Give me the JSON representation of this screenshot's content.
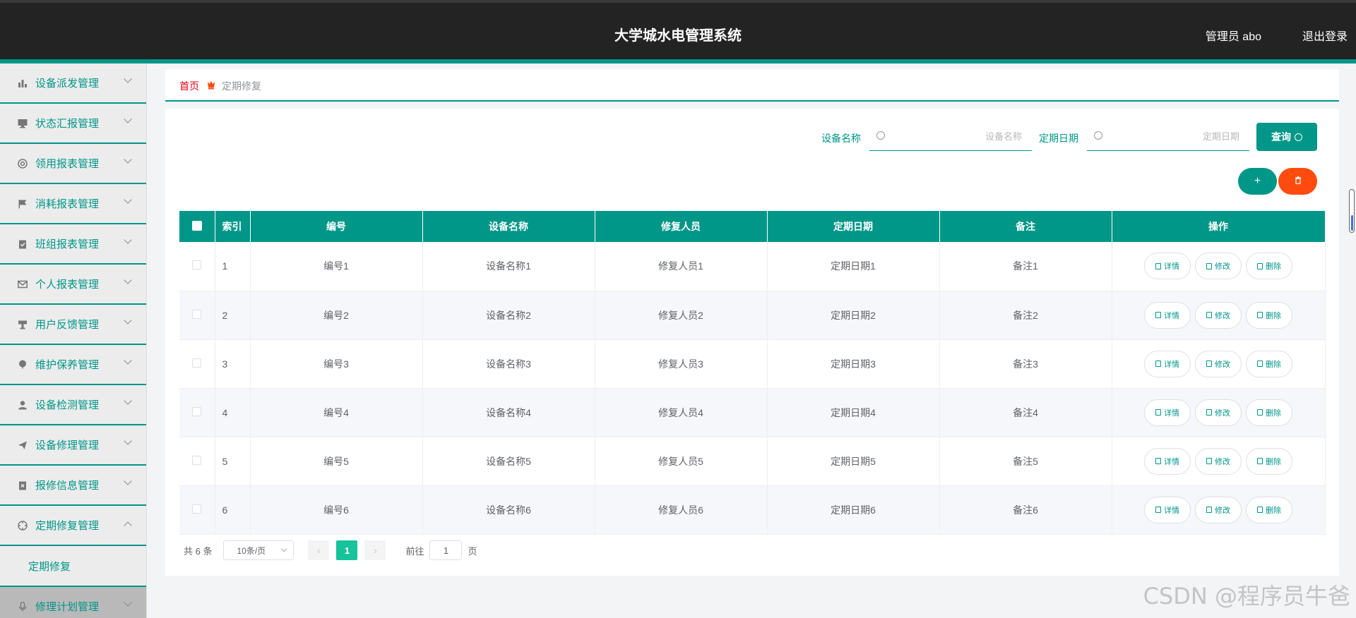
{
  "header": {
    "title": "大学城水电管理系统",
    "user": "管理员 abo",
    "logout": "退出登录"
  },
  "sidebar": {
    "items": [
      {
        "label": "设备派发管理",
        "icon": "bar-chart-icon"
      },
      {
        "label": "状态汇报管理",
        "icon": "monitor-icon"
      },
      {
        "label": "领用报表管理",
        "icon": "lifebuoy-icon"
      },
      {
        "label": "消耗报表管理",
        "icon": "flag-icon"
      },
      {
        "label": "班组报表管理",
        "icon": "clipboard-check-icon"
      },
      {
        "label": "个人报表管理",
        "icon": "mail-icon"
      },
      {
        "label": "用户反馈管理",
        "icon": "stamp-icon"
      },
      {
        "label": "维护保养管理",
        "icon": "balloon-icon"
      },
      {
        "label": "设备检测管理",
        "icon": "user-icon"
      },
      {
        "label": "设备修理管理",
        "icon": "paper-plane-icon"
      },
      {
        "label": "报修信息管理",
        "icon": "clipboard-x-icon"
      },
      {
        "label": "定期修复管理",
        "icon": "crosshair-icon"
      }
    ],
    "sub_item": "定期修复",
    "last_item": {
      "label": "修理计划管理",
      "icon": "microphone-icon"
    }
  },
  "breadcrumb": {
    "home": "首页",
    "current": "定期修复"
  },
  "search": {
    "name_label": "设备名称",
    "name_placeholder": "设备名称",
    "date_label": "定期日期",
    "date_placeholder": "定期日期",
    "query_label": "查询"
  },
  "actions": {
    "add": "+",
    "delete_icon": "trash-icon"
  },
  "table": {
    "headers": [
      "索引",
      "编号",
      "设备名称",
      "修复人员",
      "定期日期",
      "备注",
      "操作"
    ],
    "rows": [
      [
        "1",
        "编号1",
        "设备名称1",
        "修复人员1",
        "定期日期1",
        "备注1"
      ],
      [
        "2",
        "编号2",
        "设备名称2",
        "修复人员2",
        "定期日期2",
        "备注2"
      ],
      [
        "3",
        "编号3",
        "设备名称3",
        "修复人员3",
        "定期日期3",
        "备注3"
      ],
      [
        "4",
        "编号4",
        "设备名称4",
        "修复人员4",
        "定期日期4",
        "备注4"
      ],
      [
        "5",
        "编号5",
        "设备名称5",
        "修复人员5",
        "定期日期5",
        "备注5"
      ],
      [
        "6",
        "编号6",
        "设备名称6",
        "修复人员6",
        "定期日期6",
        "备注6"
      ]
    ],
    "op_labels": {
      "detail": "详情",
      "edit": "修改",
      "delete": "删除"
    }
  },
  "pagination": {
    "total": "共 6 条",
    "page_size": "10条/页",
    "prev": "‹",
    "current": "1",
    "next": "›",
    "goto_prefix": "前往",
    "goto_value": "1",
    "goto_suffix": "页"
  },
  "watermark": "CSDN @程序员牛爸",
  "colors": {
    "primary": "#009688",
    "header_bg": "#232323",
    "danger": "#ff4b0d",
    "breadcrumb_home": "#e60012",
    "page_active": "#17c39a"
  }
}
